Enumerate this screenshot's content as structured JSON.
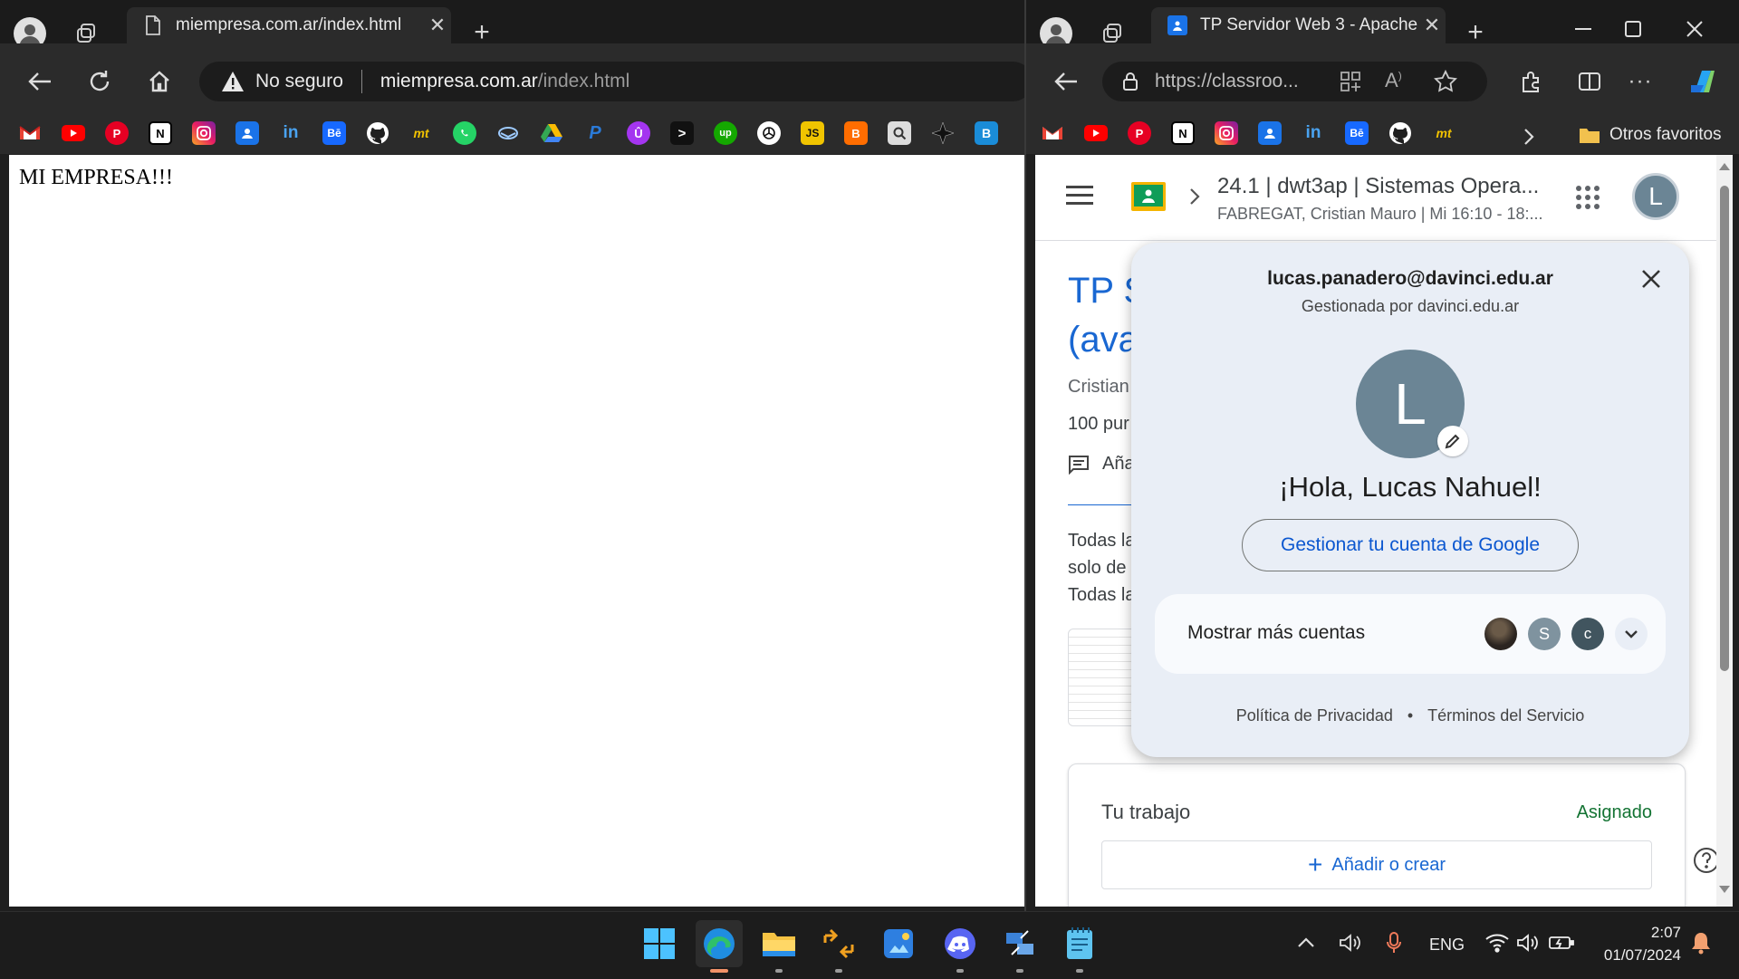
{
  "left_browser": {
    "tab_title": "miempresa.com.ar/index.html",
    "security_label": "No seguro",
    "url_domain": "miempresa.com.ar",
    "url_path": "/index.html",
    "page_text": "MI EMPRESA!!!"
  },
  "right_browser": {
    "tab_title": "TP Servidor Web 3 - Apache",
    "url": "https://classroo...",
    "other_bookmarks": "Otros favoritos",
    "classroom": {
      "course_title": "24.1 | dwt3ap | Sistemas Opera...",
      "course_sub": "FABREGAT, Cristian Mauro | Mi 16:10 - 18:...",
      "avatar_letter": "L",
      "assignment_title_1": "TP S",
      "assignment_title_2": "(ava",
      "teacher": "Cristian",
      "points": "100 pur",
      "comment_label": "Aña",
      "desc_1": "Todas la",
      "desc_2": "solo de",
      "desc_3": "Todas la",
      "work_title": "Tu trabajo",
      "work_status": "Asignado",
      "add_button": "Añadir o crear"
    },
    "account_popup": {
      "email": "lucas.panadero@davinci.edu.ar",
      "managed_by": "Gestionada por davinci.edu.ar",
      "avatar_letter": "L",
      "greeting": "¡Hola, Lucas Nahuel!",
      "manage_button": "Gestionar tu cuenta de Google",
      "more_accounts": "Mostrar más cuentas",
      "account_letters": [
        "S",
        "C"
      ],
      "privacy": "Política de Privacidad",
      "separator": "•",
      "terms": "Términos del Servicio"
    }
  },
  "bookmarks": [
    "gmail-icon",
    "youtube-icon",
    "pinterest-icon",
    "notion-icon",
    "instagram-icon",
    "contacts-icon",
    "linkedin-icon",
    "behance-icon",
    "github-icon",
    "mt-icon",
    "whatsapp-icon",
    "bookmark-icon",
    "drive-icon",
    "paypal-icon",
    "udemy-icon",
    "terminal-icon",
    "upwork-icon",
    "chatgpt-icon",
    "js-icon",
    "blogger-icon",
    "search-icon",
    "star4-icon",
    "bootstrap-icon"
  ],
  "taskbar": {
    "language": "ENG",
    "time": "2:07",
    "date": "01/07/2024"
  },
  "colors": {
    "google_blue": "#0b57d0",
    "classroom_green": "#137333",
    "popup_bg": "#e9eef6",
    "avatar_gray": "#6b8595"
  }
}
